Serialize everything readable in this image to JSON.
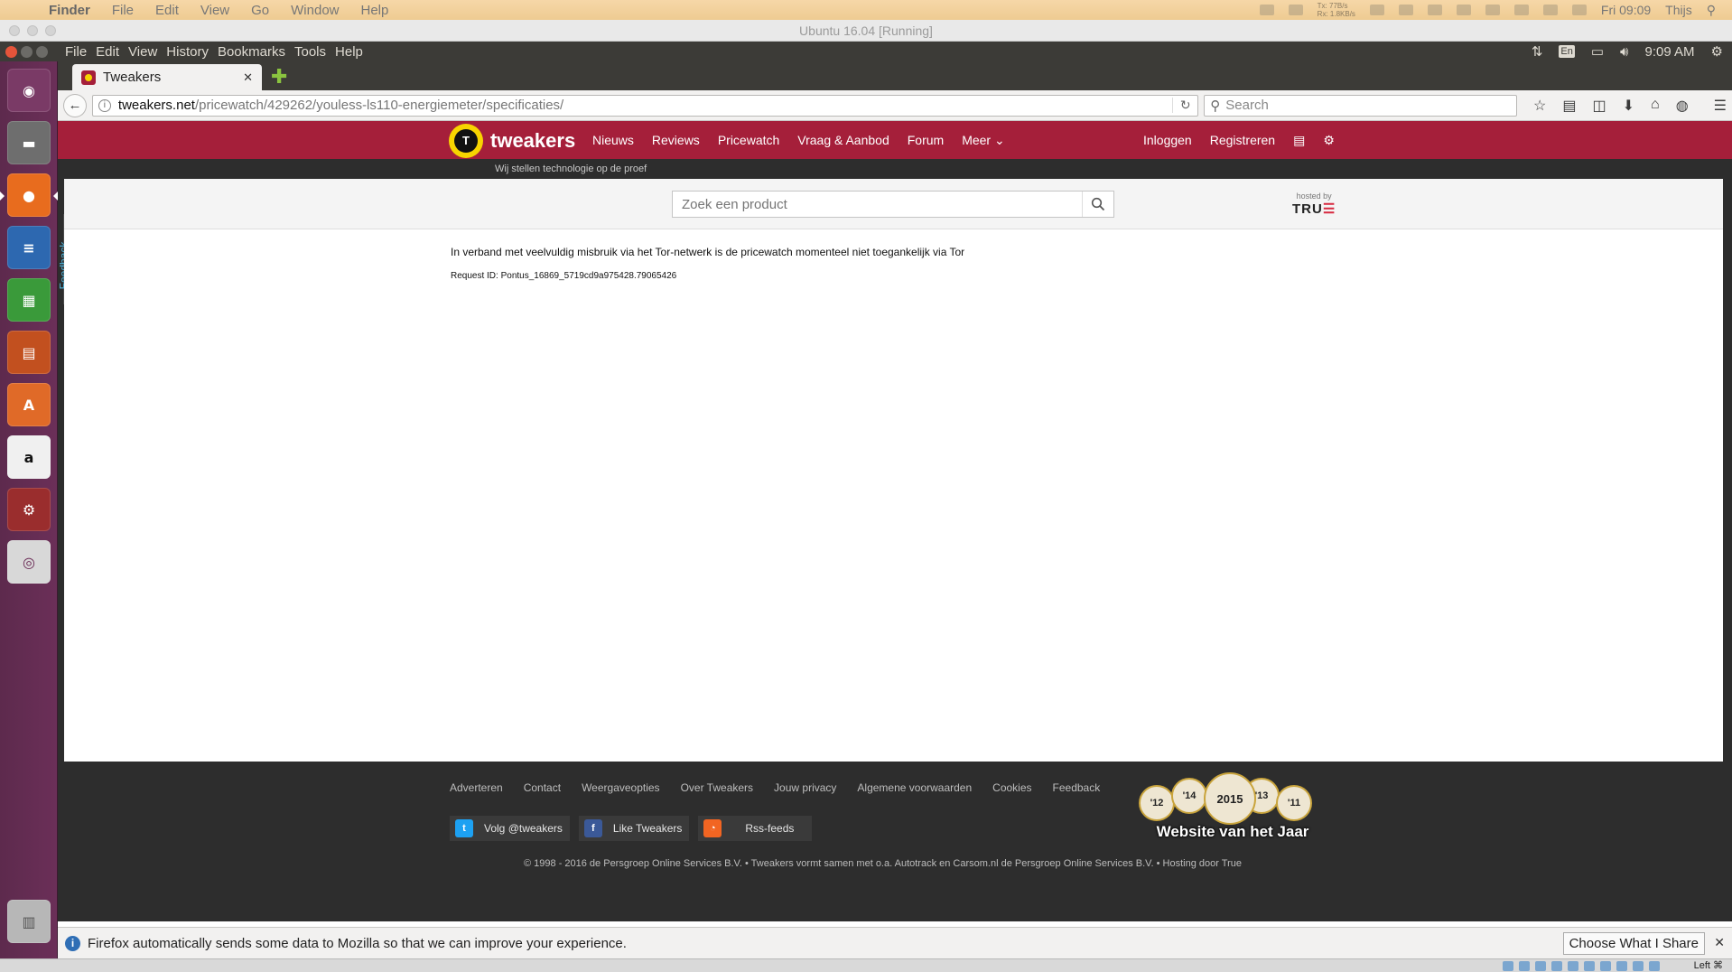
{
  "mac_menubar": {
    "app": "Finder",
    "menus": [
      "File",
      "Edit",
      "View",
      "Go",
      "Window",
      "Help"
    ],
    "net_tx": "Tx: 77B/s",
    "net_rx": "Rx: 1.8KB/s",
    "clock": "Fri 09:09",
    "user": "Thijs"
  },
  "vbox": {
    "title": "Ubuntu 16.04 [Running]",
    "host_key": "Left ⌘"
  },
  "ubuntu_panel": {
    "menus": [
      "File",
      "Edit",
      "View",
      "History",
      "Bookmarks",
      "Tools",
      "Help"
    ],
    "keyboard": "En",
    "clock": "9:09 AM"
  },
  "launcher": {
    "items": [
      "ubuntu-dash",
      "files",
      "firefox",
      "writer",
      "calc",
      "impress",
      "software-center",
      "amazon",
      "system-settings",
      "dvd"
    ]
  },
  "browser": {
    "tab_title": "Tweakers",
    "url_host": "tweakers.net",
    "url_path": "/pricewatch/429262/youless-ls110-energiemeter/specificaties/",
    "search_placeholder": "Search"
  },
  "tweakers": {
    "logo": "tweakers",
    "logo_letter": "T",
    "nav": [
      "Nieuws",
      "Reviews",
      "Pricewatch",
      "Vraag & Aanbod",
      "Forum",
      "Meer"
    ],
    "login": "Inloggen",
    "register": "Registreren",
    "tagline": "Wij stellen technologie op de proef",
    "product_search_placeholder": "Zoek een product",
    "hosted_by": "hosted by",
    "hosted_brand": "TRU",
    "message": "In verband met veelvuldig misbruik via het Tor-netwerk is de pricewatch momenteel niet toegankelijk via Tor",
    "request_id": "Request ID: Pontus_16869_5719cd9a975428.79065426",
    "feedback": "Feedback",
    "footer_links": [
      "Adverteren",
      "Contact",
      "Weergaveopties",
      "Over Tweakers",
      "Jouw privacy",
      "Algemene voorwaarden",
      "Cookies",
      "Feedback"
    ],
    "social": {
      "twitter": "Volg @tweakers",
      "facebook": "Like Tweakers",
      "rss": "Rss-feeds"
    },
    "copyright": "© 1998 - 2016 de Persgroep Online Services B.V.  •  Tweakers vormt samen met o.a. Autotrack en Carsom.nl de Persgroep Online Services B.V.  •  Hosting door True",
    "award": {
      "years": [
        "'12",
        "'14",
        "2015",
        "'13",
        "'11"
      ],
      "label": "Website van het Jaar"
    }
  },
  "notification": {
    "text": "Firefox automatically sends some data to Mozilla so that we can improve your experience.",
    "button": "Choose What I Share"
  },
  "colors": {
    "tweakers_red": "#a51f3a",
    "logo_yellow": "#f7d400",
    "launcher_purple": "#5d2a4d",
    "panel_dark": "#3c3b37"
  }
}
